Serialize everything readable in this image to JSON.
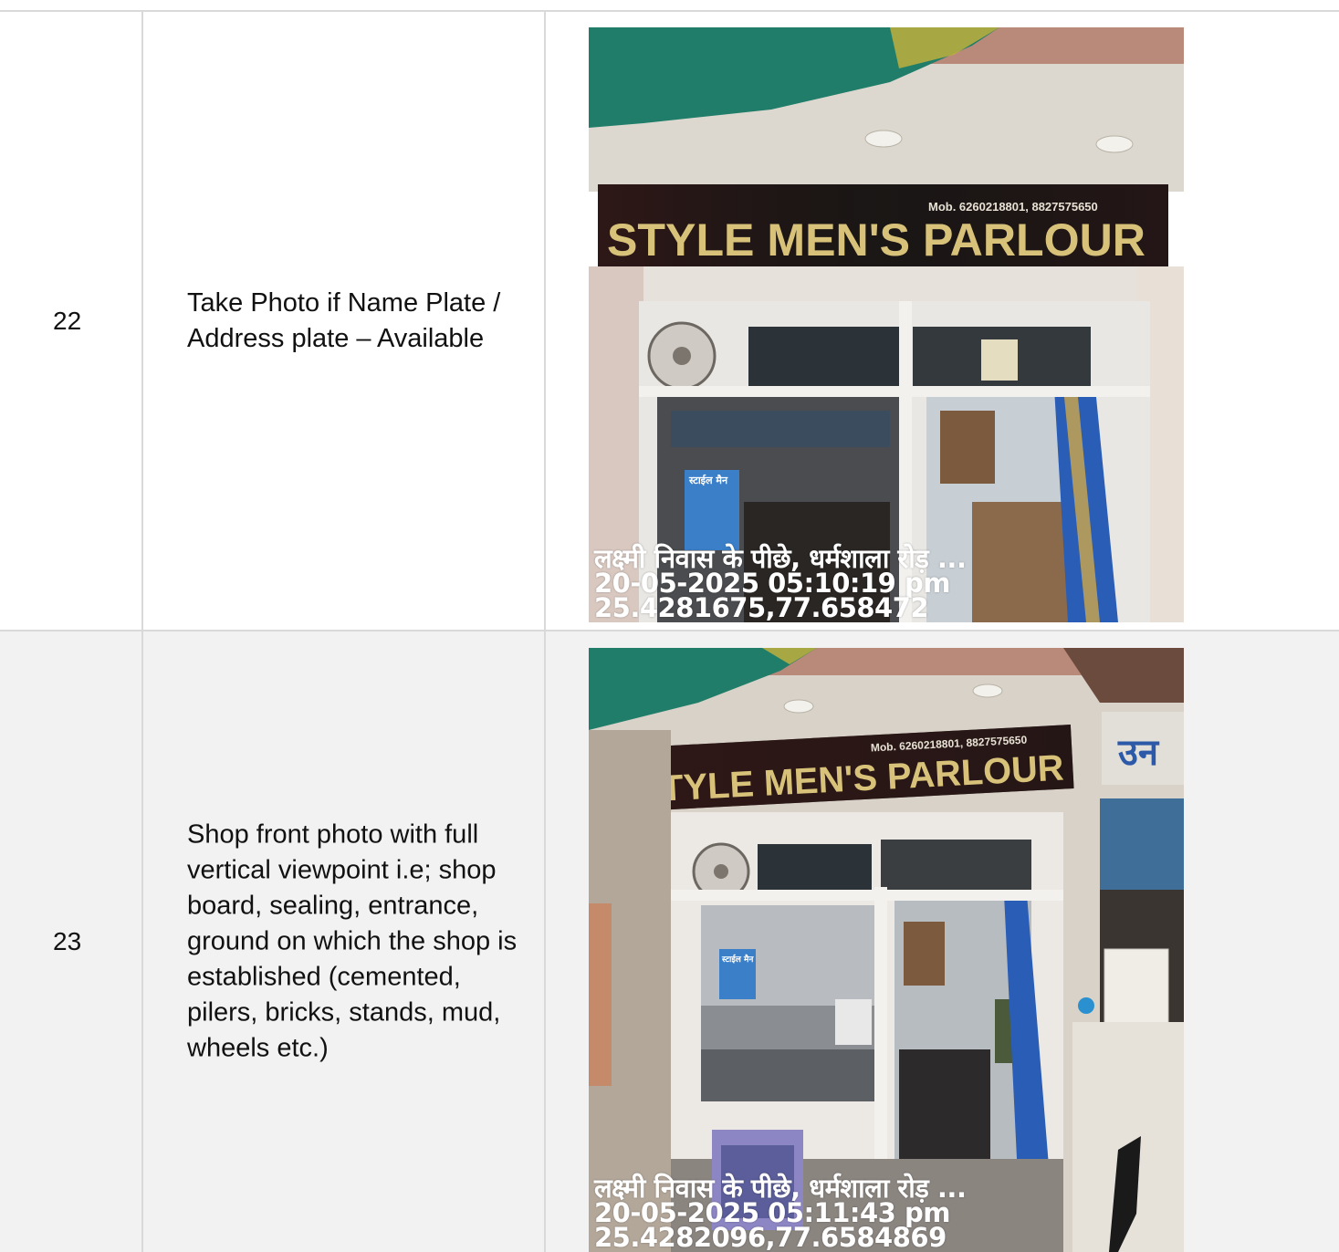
{
  "rows": [
    {
      "number": "22",
      "description": "Take Photo if Name Plate / Address plate – Available",
      "photo": {
        "sign_text": "STYLE MEN'S PARLOUR",
        "sign_phone": "Mob. 6260218801, 8827575650",
        "poster_text": "स्टाईल मैन",
        "overlay_address": "लक्ष्मी निवास के पीछे, धर्मशाला रोड़ ...",
        "overlay_datetime": "20-05-2025 05:10:19 pm",
        "overlay_coords": "25.4281675,77.658472"
      }
    },
    {
      "number": "23",
      "description": "Shop front photo with full vertical viewpoint i.e; shop board, sealing, entrance, ground on which the shop is established (cemented, pilers, bricks, stands, mud, wheels etc.)",
      "photo": {
        "sign_text": "STYLE MEN'S PARLOUR",
        "sign_phone": "Mob. 6260218801, 8827575650",
        "poster_text": "स्टाईल मैन",
        "side_sign_text": "उन",
        "overlay_address": "लक्ष्मी निवास के पीछे, धर्मशाला रोड़ ...",
        "overlay_datetime": "20-05-2025 05:11:43 pm",
        "overlay_coords": "25.4282096,77.6584869"
      }
    }
  ],
  "colors": {
    "grid": "#d9d9d9",
    "row_alt": "#f2f2f2",
    "sign_text": "#d8c27a",
    "sign_bg": "#1d1a18",
    "awning": "#1f7d6a"
  }
}
